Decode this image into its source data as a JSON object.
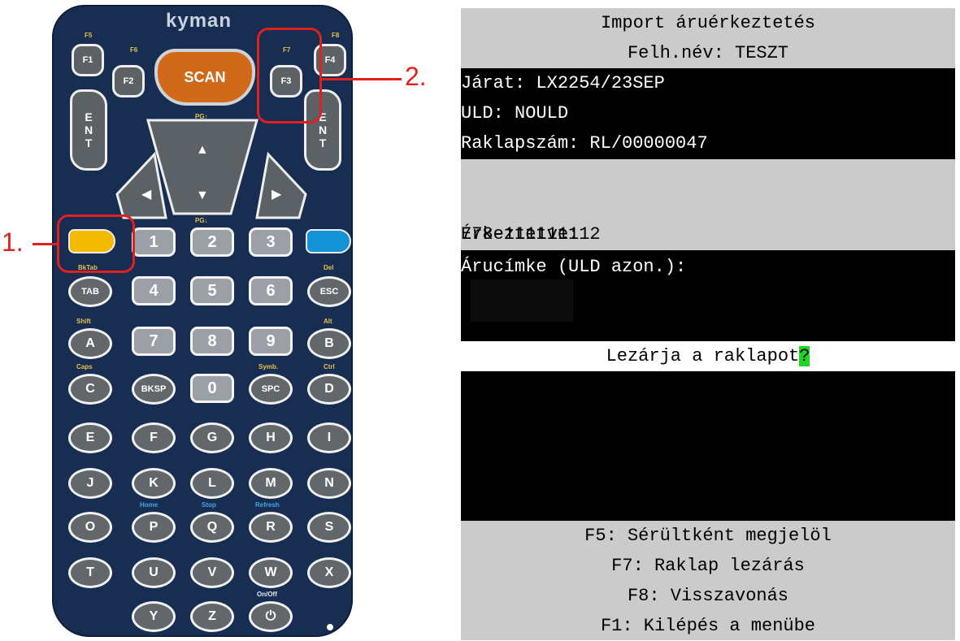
{
  "device": {
    "brand": "kyman",
    "scan_label": "SCAN",
    "f_keys": [
      {
        "label": "F1",
        "top_label": "F5"
      },
      {
        "label": "F2",
        "top_label": "F6"
      },
      {
        "label": "F3",
        "top_label": "F7"
      },
      {
        "label": "F4",
        "top_label": "F8"
      }
    ],
    "ent_label": "E\nN\nT",
    "pgup_label": "PG↑",
    "pgdn_label": "PG↓",
    "number_keys": [
      "1",
      "2",
      "3",
      "4",
      "5",
      "6",
      "7",
      "8",
      "9",
      "0"
    ],
    "tab_label": "TAB",
    "tab_top": "BkTab",
    "esc_label": "ESC",
    "esc_top": "Del",
    "bksp_label": "BKSP",
    "spc_label": "SPC",
    "spc_top": "Symb.",
    "letter_keys": [
      "A",
      "B",
      "C",
      "D",
      "E",
      "F",
      "G",
      "H",
      "I",
      "J",
      "K",
      "L",
      "M",
      "N",
      "O",
      "P",
      "Q",
      "R",
      "S",
      "T",
      "U",
      "V",
      "W",
      "X",
      "Y",
      "Z"
    ],
    "shift_label": "Shift",
    "alt_label": "Alt",
    "caps_label": "Caps",
    "ctrl_label": "Ctrl",
    "home_label": "Home",
    "stop_label": "Stop",
    "refresh_label": "Refresh",
    "onoff_label": "On/Off",
    "power_icon": "⏻"
  },
  "annotations": {
    "one": "1.",
    "two": "2."
  },
  "screen": {
    "title": "Import áruérkeztetés",
    "user": "Felh.név: TESZT",
    "flight": "Járat: LX2254/23SEP",
    "uld": "ULD: NOULD",
    "pallet": "Raklapszám: RL/00000047",
    "awb": "778-11111111",
    "arrived": "Érkeztetve: 2",
    "label_prompt": "Árucímke (ULD azon.):",
    "question": "Lezárja a raklapot",
    "cursor_char": "?",
    "menu": [
      "F5: Sérültként megjelöl",
      "F7: Raklap lezárás",
      "F8: Visszavonás",
      "F1: Kilépés a menübe"
    ]
  }
}
